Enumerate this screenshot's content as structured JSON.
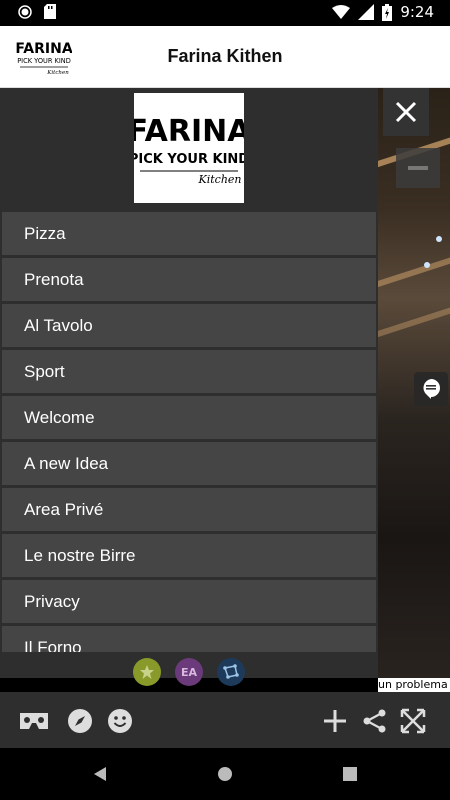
{
  "status_bar": {
    "time": "9:24"
  },
  "header": {
    "title": "Farina Kithen",
    "logo_line1": "FARINA",
    "logo_line2": "PICK YOUR KIND",
    "logo_line3": "Kitchen"
  },
  "drawer": {
    "logo_line1": "FARINA",
    "logo_line2": "PICK YOUR KIND",
    "logo_line3": "Kitchen",
    "menu": [
      {
        "label": "Pizza"
      },
      {
        "label": "Prenota"
      },
      {
        "label": "Al Tavolo"
      },
      {
        "label": "Sport"
      },
      {
        "label": "Welcome"
      },
      {
        "label": "A new Idea"
      },
      {
        "label": "Area Privé"
      },
      {
        "label": "Le nostre Birre"
      },
      {
        "label": "Privacy"
      },
      {
        "label": "Il Forno"
      }
    ],
    "bottom_icons": [
      {
        "name": "star-icon",
        "color": "#8a9a2a"
      },
      {
        "name": "ea-icon",
        "color": "#6a3a7a"
      },
      {
        "name": "constellation-icon",
        "color": "#1e3a5a"
      }
    ]
  },
  "overlay": {
    "problem_text": "un problema"
  },
  "colors": {
    "drawer_bg": "#2e2e2e",
    "menu_item_bg": "#454545",
    "header_bg": "#ffffff"
  }
}
